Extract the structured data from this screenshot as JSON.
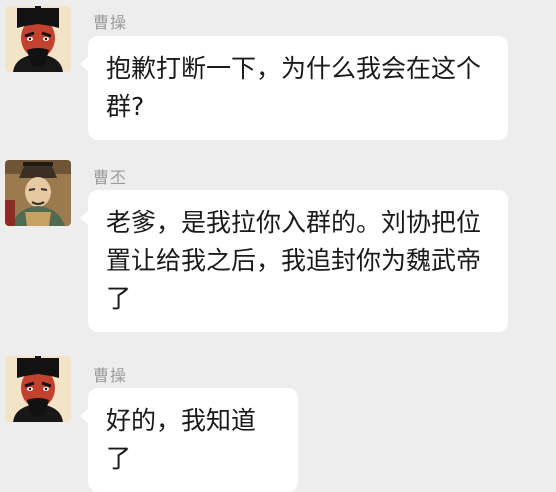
{
  "chat": {
    "messages": [
      {
        "sender": "曹操",
        "avatar_icon": "caocao-portrait-icon",
        "text": "抱歉打断一下，为什么我会在这个群?"
      },
      {
        "sender": "曹丕",
        "avatar_icon": "caopi-portrait-icon",
        "text": "老爹，是我拉你入群的。刘协把位置让给我之后，我追封你为魏武帝了"
      },
      {
        "sender": "曹操",
        "avatar_icon": "caocao-portrait-icon",
        "text": "好的，我知道了"
      }
    ]
  },
  "colors": {
    "background": "#ededed",
    "bubble": "#ffffff",
    "sender_name": "#9a9a9a",
    "text": "#1a1a1a"
  }
}
